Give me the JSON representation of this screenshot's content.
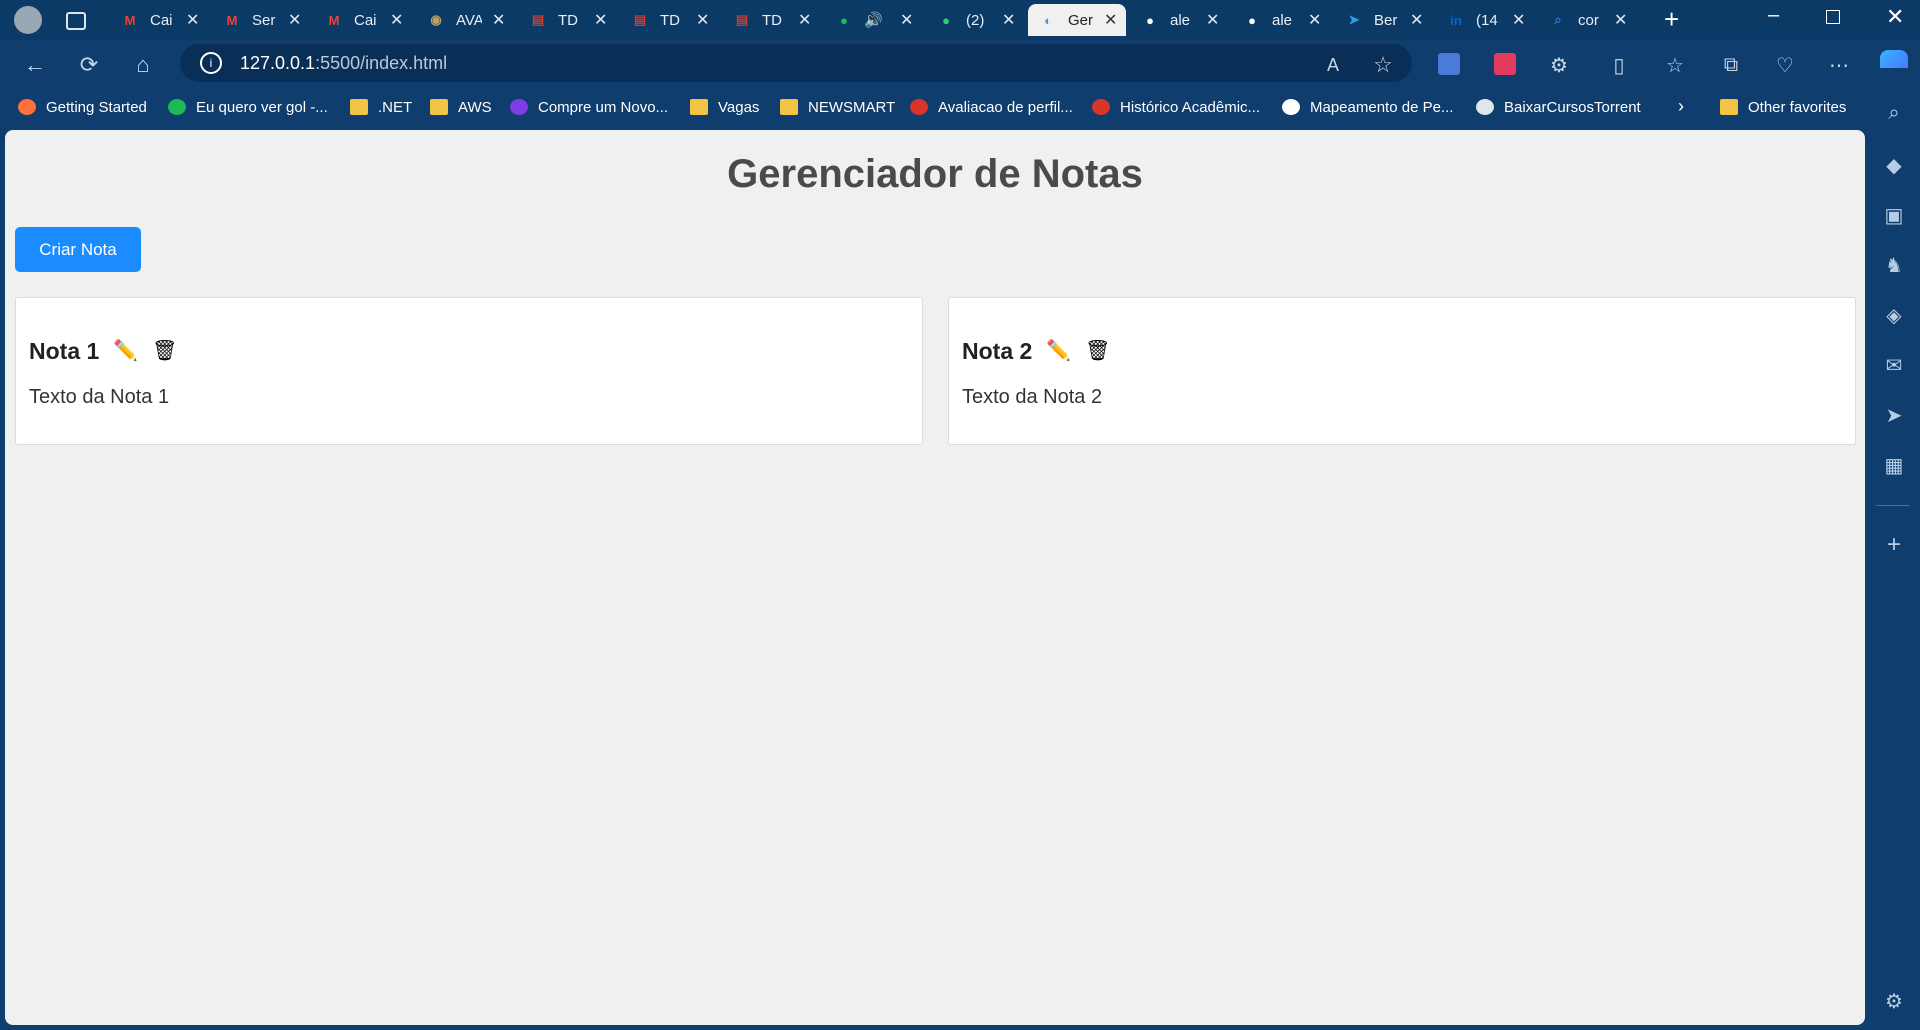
{
  "tabs": [
    {
      "label": "Cai",
      "icon": "gmail-icon"
    },
    {
      "label": "Ser",
      "icon": "gmail-icon"
    },
    {
      "label": "Cai",
      "icon": "gmail-icon"
    },
    {
      "label": "AVA",
      "icon": "ava-icon"
    },
    {
      "label": "TD",
      "icon": "pdf-icon"
    },
    {
      "label": "TD",
      "icon": "pdf-icon"
    },
    {
      "label": "TD",
      "icon": "pdf-icon"
    },
    {
      "label": "",
      "icon": "spotify-icon"
    },
    {
      "label": "(2)",
      "icon": "whatsapp-icon"
    },
    {
      "label": "Ger",
      "icon": "notes-icon",
      "active": true
    },
    {
      "label": "ale",
      "icon": "github-icon"
    },
    {
      "label": "ale",
      "icon": "github-icon"
    },
    {
      "label": "Ber",
      "icon": "telegram-icon"
    },
    {
      "label": "(14",
      "icon": "linkedin-icon"
    },
    {
      "label": "cor",
      "icon": "search-icon"
    }
  ],
  "address": {
    "host": "127.0.0.1",
    "path": ":5500/index.html"
  },
  "bookmarks": [
    "Getting Started",
    "Eu quero ver gol -...",
    ".NET",
    "AWS",
    "Compre um Novo...",
    "Vagas",
    "NEWSMART",
    "Avaliacao de perfil...",
    "Histórico Acadêmic...",
    "Mapeamento de Pe...",
    "BaixarCursosTorrent"
  ],
  "other_favorites": "Other favorites",
  "app": {
    "title": "Gerenciador de Notas",
    "create_button": "Criar Nota",
    "notes": [
      {
        "title": "Nota 1",
        "text": "Texto da Nota 1"
      },
      {
        "title": "Nota 2",
        "text": "Texto da Nota 2"
      }
    ]
  }
}
